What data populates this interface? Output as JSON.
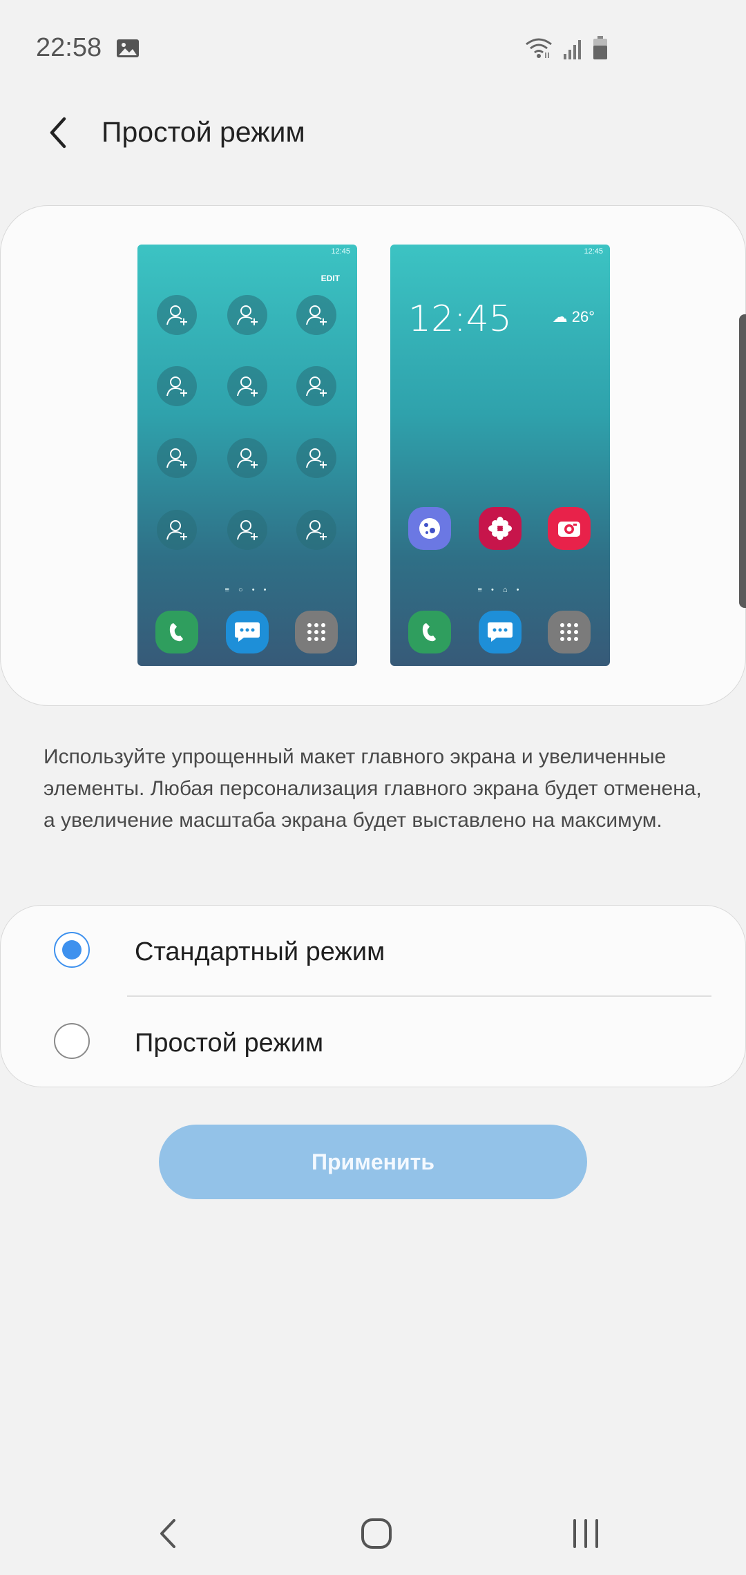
{
  "status_bar": {
    "time": "22:58"
  },
  "header": {
    "title": "Простой режим"
  },
  "preview": {
    "phone_time": "12:45",
    "edit_label": "EDIT",
    "clock": "12:45",
    "weather": "26°"
  },
  "description": "Используйте упрощенный макет главного экрана и увеличенные элементы. Любая персонализация главного экрана будет отменена, а увеличение масштаба экрана будет выставлено на максимум.",
  "options": [
    {
      "label": "Стандартный режим",
      "selected": true
    },
    {
      "label": "Простой режим",
      "selected": false
    }
  ],
  "apply_label": "Применить",
  "colors": {
    "accent": "#3e91ee",
    "apply_bg": "#93c2e8",
    "background": "#f2f2f2"
  }
}
